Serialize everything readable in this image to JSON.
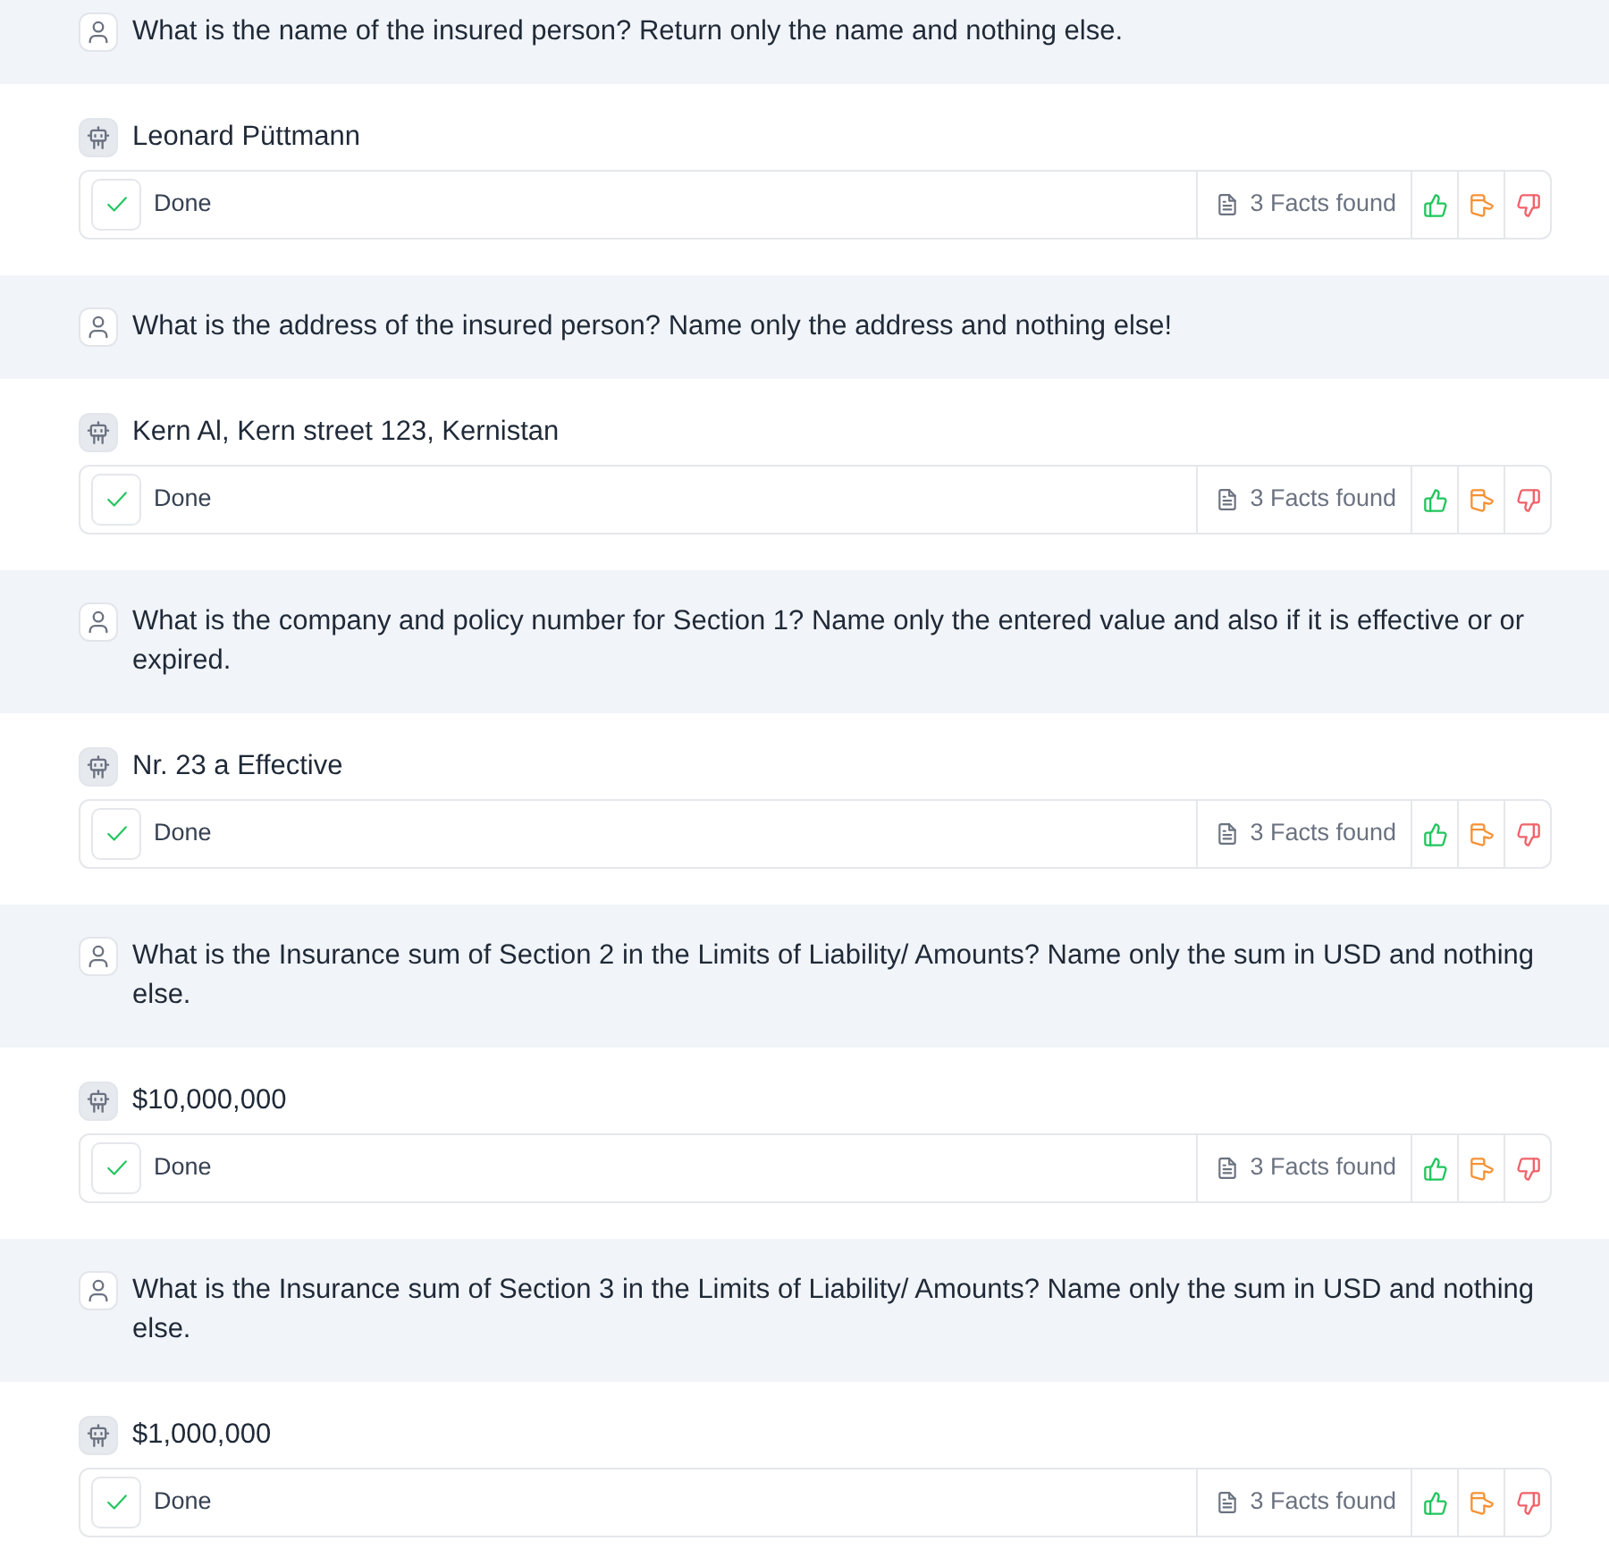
{
  "messages": [
    {
      "kind": "question",
      "text": "What is the name of the insured person? Return only the name and nothing else."
    },
    {
      "kind": "answer",
      "text": "Leonard Püttmann",
      "status": "Done",
      "facts": "3 Facts found"
    },
    {
      "kind": "question",
      "text": "What is the address of the insured person? Name only the address and nothing else!"
    },
    {
      "kind": "answer",
      "text": "Kern Al, Kern street 123, Kernistan",
      "status": "Done",
      "facts": "3 Facts found"
    },
    {
      "kind": "question",
      "text": "What is the company and policy number for Section 1? Name only the entered value and also if it is effective or or expired."
    },
    {
      "kind": "answer",
      "text": "Nr. 23 a Effective",
      "status": "Done",
      "facts": "3 Facts found"
    },
    {
      "kind": "question",
      "text": "What is the Insurance sum of Section 2 in the Limits of Liability/ Amounts? Name only the sum in USD and nothing else."
    },
    {
      "kind": "answer",
      "text": "$10,000,000",
      "status": "Done",
      "facts": "3 Facts found"
    },
    {
      "kind": "question",
      "text": "What is the Insurance sum of Section 3 in the Limits of Liability/ Amounts? Name only the sum in USD and nothing else."
    },
    {
      "kind": "answer",
      "text": "$1,000,000",
      "status": "Done",
      "facts": "3 Facts found"
    }
  ]
}
